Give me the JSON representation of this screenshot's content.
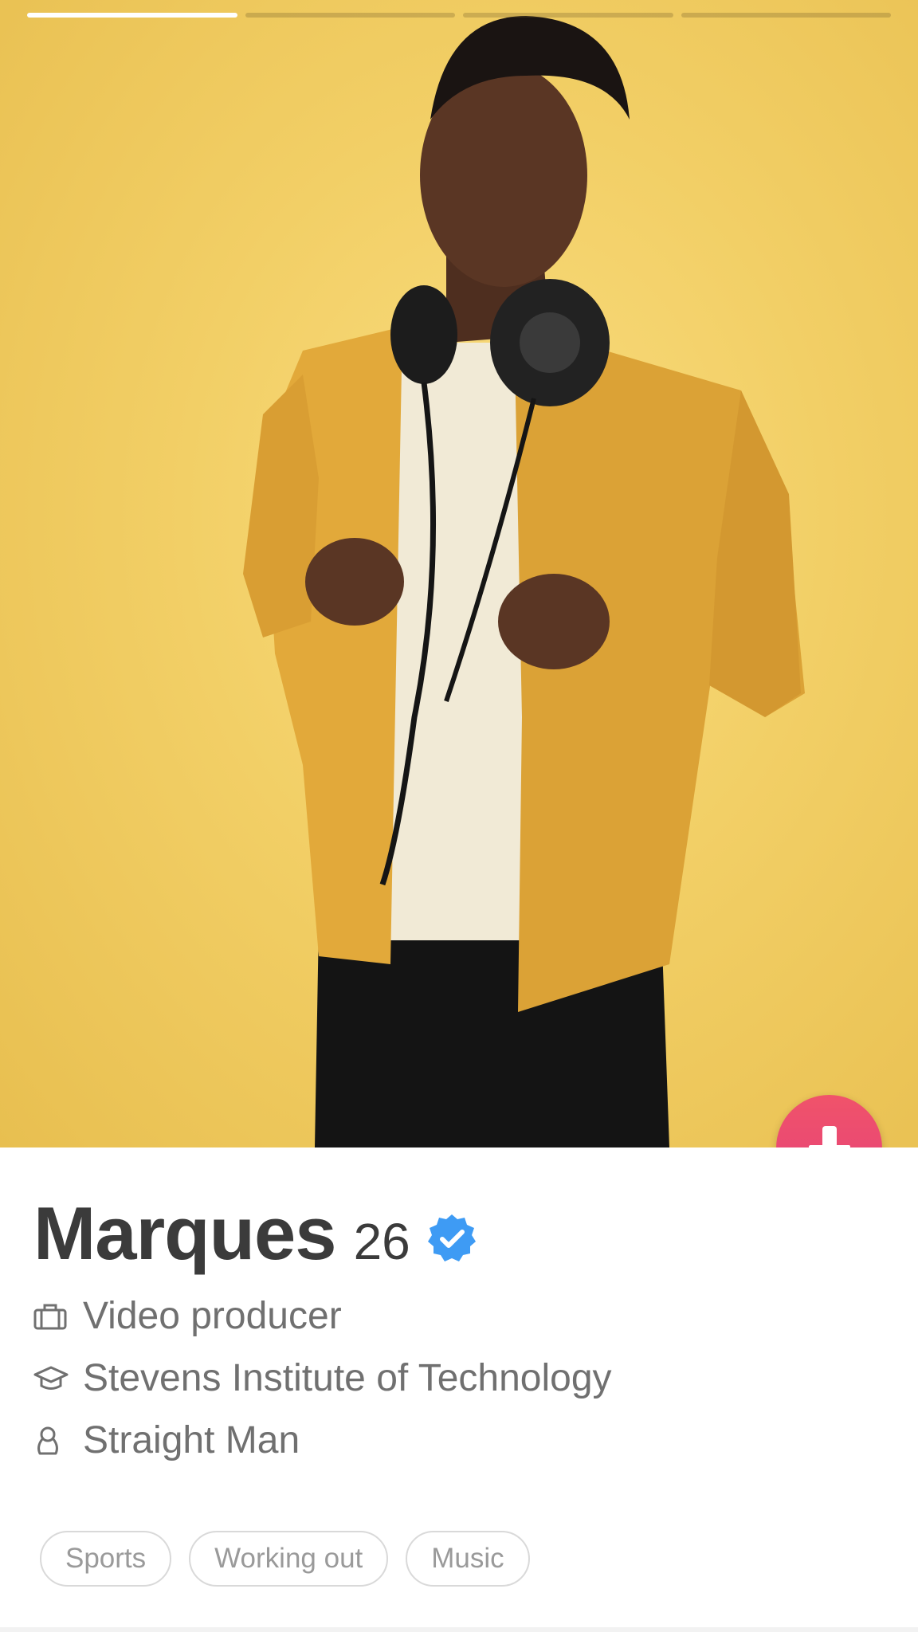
{
  "photo": {
    "alt": "Marques",
    "background_color": "#f2cf66",
    "progress": {
      "total": 4,
      "active_index": 0
    }
  },
  "profile": {
    "name": "Marques",
    "age": "26",
    "verified": true,
    "verified_icon": "verified-badge-icon",
    "job": "Video producer",
    "school": "Stevens Institute of Technology",
    "identity": "Straight Man"
  },
  "icons": {
    "job": "briefcase-icon",
    "school": "graduation-cap-icon",
    "identity": "person-icon",
    "action": "arrow-down-icon"
  },
  "interests": [
    "Sports",
    "Working out",
    "Music"
  ],
  "colors": {
    "accent_gradient_top": "#f0536a",
    "accent_gradient_bottom": "#e5417a",
    "verified_blue": "#3e9bf4",
    "name_text": "#3b3b3b",
    "detail_text": "#707070",
    "tag_text": "#9a9a9a"
  }
}
